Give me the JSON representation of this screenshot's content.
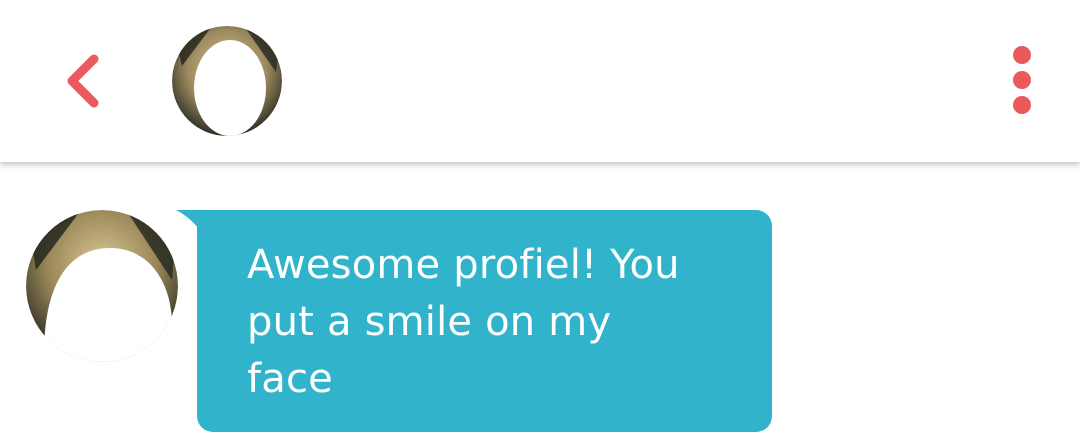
{
  "colors": {
    "accent": "#ea5a5c",
    "bubble": "#30b3cb",
    "bubble_text": "#ffffff",
    "background": "#ffffff"
  },
  "header": {
    "back_icon": "chevron-left-icon",
    "more_icon": "vertical-ellipsis-icon"
  },
  "messages": [
    {
      "sender": "match",
      "text": "Awesome profiel! You\nput a smile on my\nface"
    }
  ]
}
